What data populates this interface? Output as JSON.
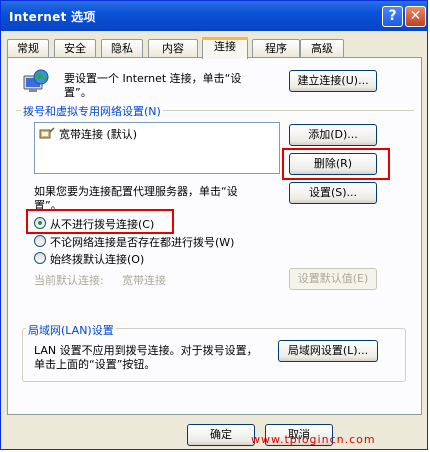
{
  "window": {
    "title": "Internet 选项",
    "help_glyph": "?",
    "close_glyph": "✕"
  },
  "tabs": [
    {
      "label": "常规"
    },
    {
      "label": "安全"
    },
    {
      "label": "隐私"
    },
    {
      "label": "内容"
    },
    {
      "label": "连接",
      "active": true
    },
    {
      "label": "程序"
    },
    {
      "label": "高级"
    }
  ],
  "setup": {
    "text_line1": "要设置一个 Internet 连接，单击“设",
    "text_line2": "置”。",
    "button": "建立连接(U)..."
  },
  "dialup": {
    "group_title": "拨号和虚拟专用网络设置(N)",
    "entries": [
      "宽带连接 (默认)"
    ],
    "add_button": "添加(D)...",
    "delete_button": "删除(R)",
    "proxy_text_line1": "如果您要为连接配置代理服务器，单击“设",
    "proxy_text_line2": "置”。",
    "settings_button": "设置(S)...",
    "options": [
      {
        "label": "从不进行拨号连接(C)",
        "selected": true
      },
      {
        "label": "不论网络连接是否存在都进行拨号(W)",
        "selected": false
      },
      {
        "label": "始终拨默认连接(O)",
        "selected": false
      }
    ],
    "current_default_label": "当前默认连接:",
    "current_default_value": "宽带连接",
    "set_default_button": "设置默认值(E)"
  },
  "lan": {
    "group_title": "局域网(LAN)设置",
    "text_line1": "LAN 设置不应用到拨号连接。对于拨号设置，",
    "text_line2": "单击上面的“设置”按钮。",
    "button": "局域网设置(L)..."
  },
  "footer": {
    "ok_button": "确定",
    "cancel_button": "取消"
  },
  "watermark": "www.tplogincn.com",
  "colors": {
    "highlight_red": "#e00000",
    "titlebar_blue": "#0a52d8",
    "group_title_blue": "#0046d5"
  }
}
